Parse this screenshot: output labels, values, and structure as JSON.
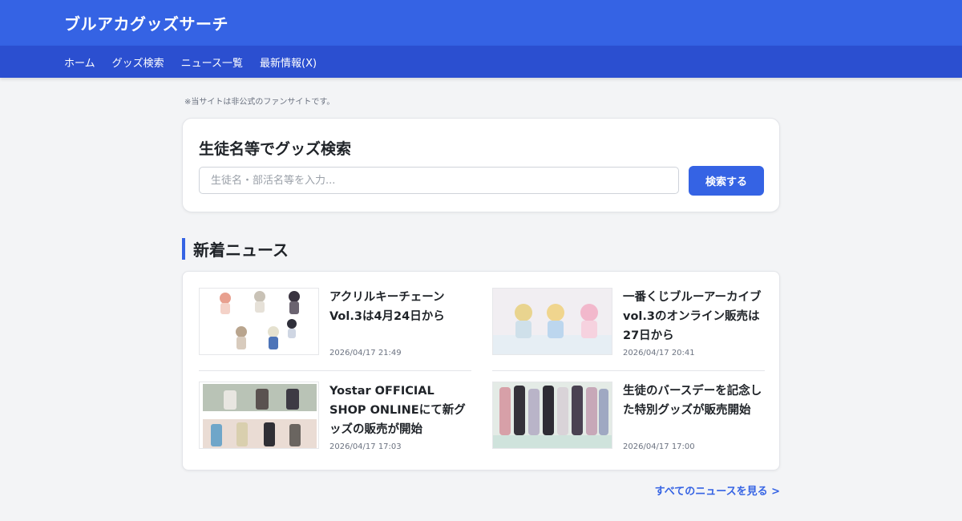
{
  "header": {
    "site_title": "ブルアカグッズサーチ"
  },
  "nav": {
    "items": [
      {
        "label": "ホーム"
      },
      {
        "label": "グッズ検索"
      },
      {
        "label": "ニュース一覧"
      },
      {
        "label": "最新情報(X)"
      }
    ]
  },
  "notice": "※当サイトは非公式のファンサイトです。",
  "search": {
    "title": "生徒名等でグッズ検索",
    "placeholder": "生徒名・部活名等を入力...",
    "value": "",
    "button_label": "検索する"
  },
  "news": {
    "heading": "新着ニュース",
    "items": [
      {
        "title": "アクリルキーチェーンVol.3は4月24日から",
        "date": "2026/04/17 21:49"
      },
      {
        "title": "一番くじブルーアーカイブvol.3のオンライン販売は27日から",
        "date": "2026/04/17 20:41"
      },
      {
        "title": "Yostar OFFICIAL SHOP ONLINEにて新グッズの販売が開始",
        "date": "2026/04/17 17:03"
      },
      {
        "title": "生徒のバースデーを記念した特別グッズが販売開始",
        "date": "2026/04/17 17:00"
      }
    ],
    "all_link": "すべてのニュースを見る >"
  },
  "colors": {
    "primary": "#3563e4",
    "nav_bg": "#2b4fd0",
    "page_bg": "#f3f4f6"
  }
}
